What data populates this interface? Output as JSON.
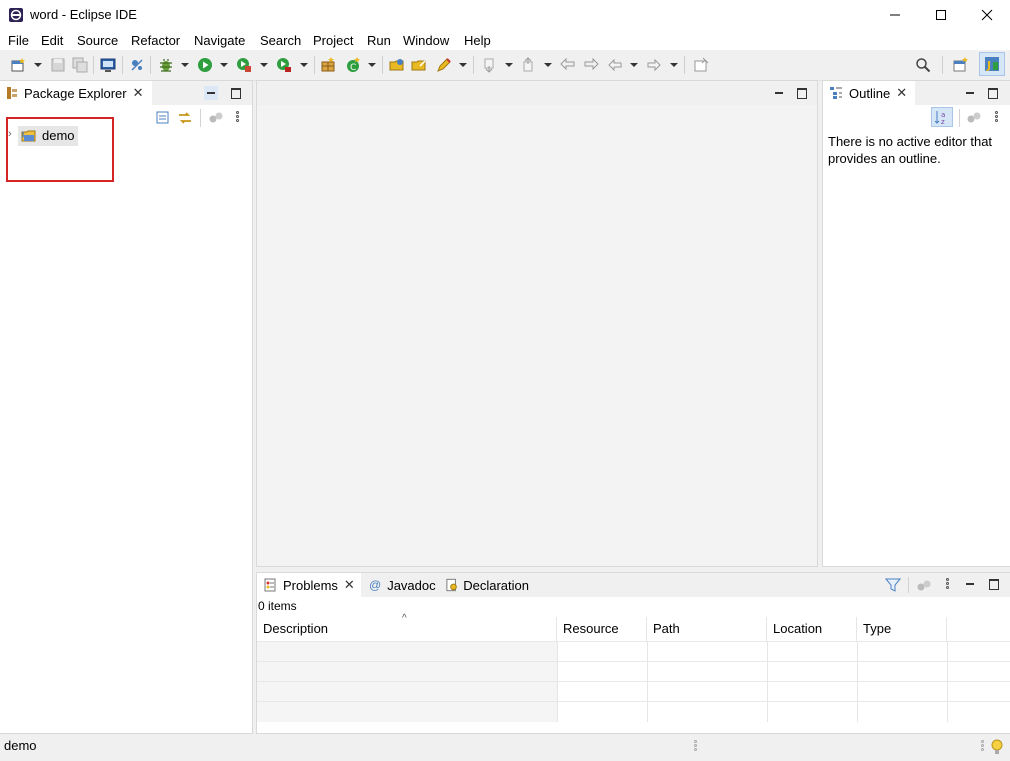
{
  "window": {
    "title": "word - Eclipse IDE",
    "minimize_icon": "minimize-icon",
    "maximize_icon": "maximize-icon",
    "close_icon": "close-icon"
  },
  "menu": [
    "File",
    "Edit",
    "Source",
    "Refactor",
    "Navigate",
    "Search",
    "Project",
    "Run",
    "Window",
    "Help"
  ],
  "package_explorer": {
    "tab_label": "Package Explorer",
    "tree": [
      {
        "label": "demo",
        "icon": "java-project-icon",
        "expanded": false,
        "selected": true
      }
    ],
    "highlight_color": "#d42424"
  },
  "outline": {
    "tab_label": "Outline",
    "message": "There is no active editor that provides an outline."
  },
  "bottom": {
    "tabs": [
      {
        "label": "Problems",
        "icon": "problems-icon",
        "active": true
      },
      {
        "label": "Javadoc",
        "icon": "at-icon",
        "active": false
      },
      {
        "label": "Declaration",
        "icon": "declaration-icon",
        "active": false
      }
    ],
    "item_count": "0 items",
    "columns": [
      "Description",
      "Resource",
      "Path",
      "Location",
      "Type"
    ]
  },
  "statusbar": {
    "text": "demo"
  },
  "colors": {
    "accent_blue": "#1a73b8",
    "run_green": "#2e9e3e"
  }
}
